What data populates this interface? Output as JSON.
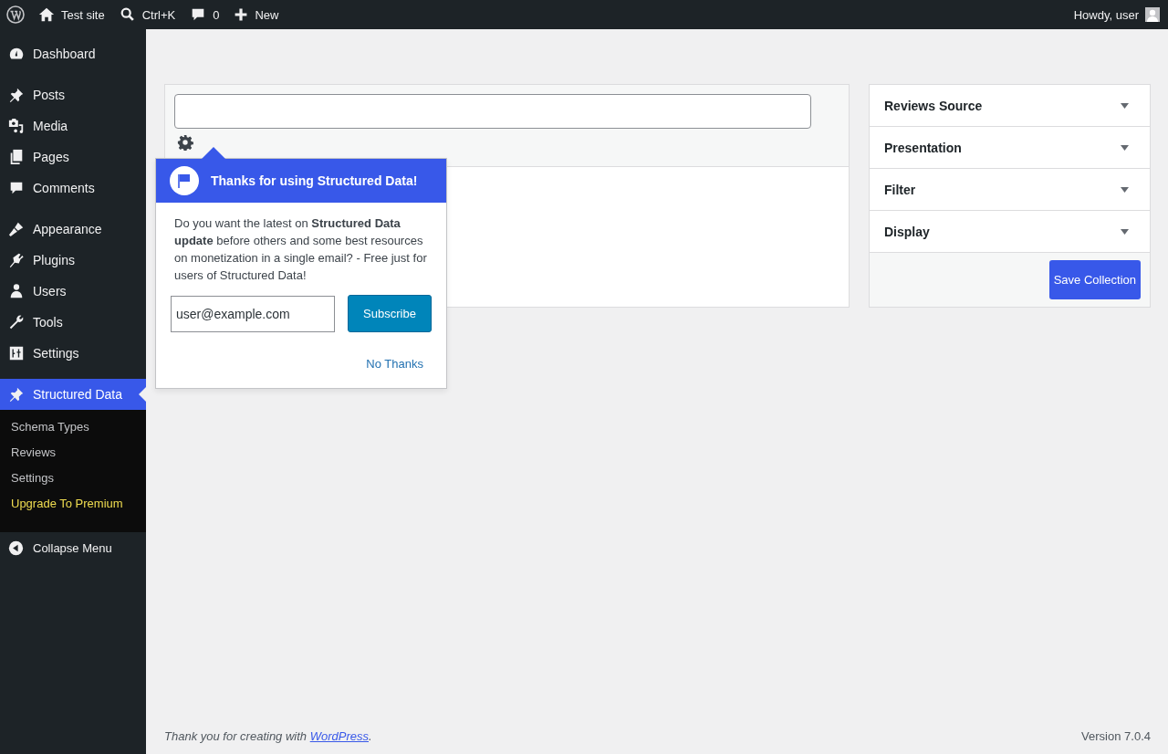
{
  "admin_bar": {
    "items": [
      {
        "kind": "logo"
      },
      {
        "kind": "home",
        "label": "Test site"
      },
      {
        "kind": "search",
        "label": "Ctrl+K"
      },
      {
        "kind": "comment",
        "label": "0"
      },
      {
        "kind": "plus",
        "label": "New"
      }
    ],
    "greeting": "Howdy, user"
  },
  "sidebar": {
    "groups": [
      {
        "items": [
          {
            "kind": "dashboard",
            "label": "Dashboard",
            "selected": false
          }
        ]
      },
      {
        "items": [
          {
            "kind": "pin",
            "label": "Posts",
            "selected": false
          },
          {
            "kind": "media",
            "label": "Media",
            "selected": false
          },
          {
            "kind": "pages",
            "label": "Pages",
            "selected": false
          },
          {
            "kind": "comment",
            "label": "Comments",
            "selected": false
          }
        ]
      },
      {
        "items": [
          {
            "kind": "brush",
            "label": "Appearance",
            "selected": false
          },
          {
            "kind": "plug",
            "label": "Plugins",
            "selected": false
          },
          {
            "kind": "user",
            "label": "Users",
            "selected": false
          },
          {
            "kind": "wrench",
            "label": "Tools",
            "selected": false
          },
          {
            "kind": "sliders",
            "label": "Settings",
            "selected": false
          }
        ]
      },
      {
        "items": [
          {
            "kind": "pin",
            "label": "Structured Data",
            "selected": true
          }
        ]
      }
    ],
    "submenu": [
      {
        "kind": "link",
        "label": "Schema Types"
      },
      {
        "kind": "link",
        "label": "Reviews"
      },
      {
        "kind": "link",
        "label": "Settings"
      },
      {
        "kind": "premium",
        "label": "Upgrade To Premium"
      }
    ],
    "collapse": "Collapse Menu"
  },
  "popup": {
    "title": "Thanks for using Structured Data!",
    "message": "Do you want the latest on **Structured Data update** before others and some best resources on monetization in a single email? - Free just for users of Structured Data!",
    "email_value": "user@example.com",
    "subscribe": "Subscribe",
    "dismiss": "No Thanks"
  },
  "panels": [
    {
      "title": "Reviews Source",
      "expanded": false
    },
    {
      "title": "Presentation",
      "expanded": false
    },
    {
      "title": "Filter",
      "expanded": false
    },
    {
      "title": "Display",
      "expanded": false
    }
  ],
  "save_button": "Save Collection",
  "footer": {
    "thanks": "Thank you for creating with",
    "link": "WordPress",
    "thanks_end": ".",
    "version": "Version 7.0.4"
  }
}
